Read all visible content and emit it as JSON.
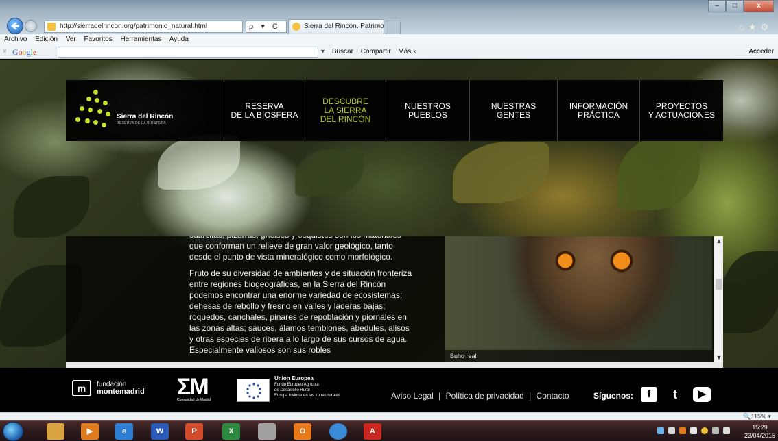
{
  "browser": {
    "url": "http://sierradelrincon.org/patrimonio_natural.html",
    "address_tools": "ρ ▾ C",
    "tab_title": "Sierra del Rincón. Patrimoni...",
    "tab_close": "×",
    "window_controls": {
      "minimize": "–",
      "maximize": "□",
      "close": "x"
    },
    "menu": [
      "Archivo",
      "Edición",
      "Ver",
      "Favoritos",
      "Herramientas",
      "Ayuda"
    ],
    "google_toolbar": {
      "close": "×",
      "logo": "Google",
      "search_label": "Buscar",
      "share_label": "Compartir",
      "more_label": "Más »",
      "signin_label": "Acceder"
    },
    "zoom": "115%"
  },
  "site": {
    "logo_title": "Sierra del Rincón",
    "logo_subtitle": "RESERVA DE LA BIOSFERA",
    "nav": [
      {
        "line1": "RESERVA",
        "line2": "DE LA BIOSFERA",
        "line3": ""
      },
      {
        "line1": "DESCUBRE",
        "line2": "LA SIERRA",
        "line3": "DEL RINCÓN"
      },
      {
        "line1": "NUESTROS",
        "line2": "PUEBLOS",
        "line3": ""
      },
      {
        "line1": "NUESTRAS",
        "line2": "GENTES",
        "line3": ""
      },
      {
        "line1": "INFORMACIÓN",
        "line2": "PRÁCTICA",
        "line3": ""
      },
      {
        "line1": "PROYECTOS",
        "line2": "Y ACTUACIONES",
        "line3": ""
      }
    ],
    "active_nav_index": 1,
    "body_text": [
      "cuarcitas, pizarras, gneises y esquistos son los materiales que conforman un relieve de gran valor geológico, tanto desde el punto de vista mineralógico como morfológico.",
      "Fruto de su diversidad de ambientes y de situación fronteriza entre regiones biogeográficas, en la Sierra del Rincón podemos encontrar una enorme variedad de ecosistemas: dehesas de rebollo y fresno en valles y laderas bajas; roquedos, canchales, pinares de repoblación y piornales en las zonas altas; sauces, álamos temblones, abedules, alisos y otras especies de ribera a lo largo de sus cursos de agua. Especialmente valiosos son sus robles"
    ],
    "photo_caption": "Buho real",
    "footer": {
      "fundacion_line1": "fundación",
      "fundacion_line2": "montemadrid",
      "cm_subtitle": "Comunidad de Madrid",
      "ue_title": "Unión Europea",
      "ue_line1": "Fondo Europeo Agrícola",
      "ue_line2": "de Desarrollo Rural",
      "ue_line3": "Europa invierte en las zonas rurales",
      "links": [
        "Aviso Legal",
        "|",
        "Política de privacidad",
        "|",
        "Contacto"
      ],
      "siguenos": "Síguenos:",
      "social": [
        "f",
        "t",
        "▶"
      ]
    }
  },
  "taskbar": {
    "clock_time": "15:29",
    "clock_date": "23/04/2015"
  },
  "colors": {
    "accent": "#b7c42a",
    "nav_bg": "#000000"
  }
}
